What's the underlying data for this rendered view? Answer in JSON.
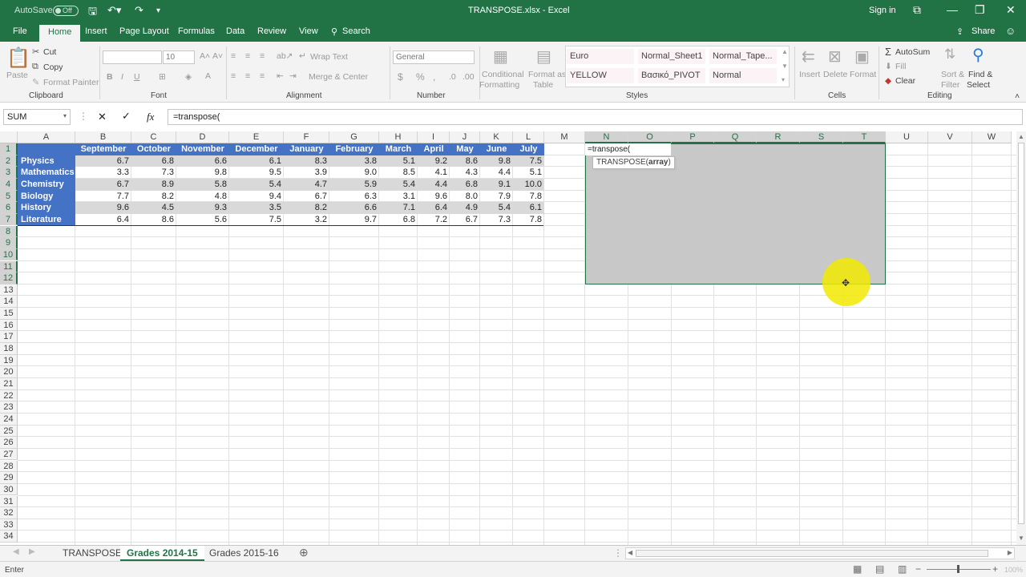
{
  "titlebar": {
    "autosave_label": "AutoSave",
    "autosave_state": "Off",
    "title": "TRANSPOSE.xlsx - Excel",
    "signin": "Sign in"
  },
  "tabs": [
    "File",
    "Home",
    "Insert",
    "Page Layout",
    "Formulas",
    "Data",
    "Review",
    "View",
    "Search"
  ],
  "share": "Share",
  "ribbon": {
    "clipboard": {
      "paste": "Paste",
      "cut": "Cut",
      "copy": "Copy",
      "format_painter": "Format Painter",
      "label": "Clipboard"
    },
    "font": {
      "size": "10",
      "label": "Font",
      "bold": "B",
      "italic": "I",
      "underline": "U"
    },
    "alignment": {
      "wrap": "Wrap Text",
      "merge": "Merge & Center",
      "label": "Alignment"
    },
    "number": {
      "format": "General",
      "label": "Number",
      "currency": "$",
      "percent": "%",
      "comma": ","
    },
    "styles": {
      "cond1": "Conditional",
      "cond2": "Formatting",
      "fat1": "Format as",
      "fat2": "Table",
      "items": [
        "Euro",
        "Normal_Sheet1",
        "Normal_Tape...",
        "YELLOW",
        "Βασικό_PIVOT",
        "Normal"
      ],
      "label": "Styles"
    },
    "cells": {
      "insert": "Insert",
      "delete": "Delete",
      "format": "Format",
      "label": "Cells"
    },
    "editing": {
      "autosum": "AutoSum",
      "fill": "Fill",
      "clear": "Clear",
      "sort1": "Sort &",
      "sort2": "Filter",
      "find1": "Find &",
      "find2": "Select",
      "label": "Editing"
    }
  },
  "formula_bar": {
    "name_box": "SUM",
    "fx": "fx",
    "formula": "=transpose("
  },
  "columns": [
    "A",
    "B",
    "C",
    "D",
    "E",
    "F",
    "G",
    "H",
    "I",
    "J",
    "K",
    "L",
    "M",
    "N",
    "O",
    "P",
    "Q",
    "R",
    "S",
    "T",
    "U",
    "V",
    "W"
  ],
  "rows": [
    "1",
    "2",
    "3",
    "4",
    "5",
    "6",
    "7",
    "8",
    "9",
    "10",
    "11",
    "12",
    "13",
    "14",
    "15",
    "16",
    "17",
    "18",
    "19",
    "20",
    "21",
    "22",
    "23",
    "24",
    "25",
    "26",
    "27",
    "28",
    "29",
    "30",
    "31",
    "32",
    "33",
    "34"
  ],
  "table": {
    "header": [
      "September",
      "October",
      "November",
      "December",
      "January",
      "February",
      "March",
      "April",
      "May",
      "June",
      "July"
    ],
    "body": [
      {
        "name": "Physics",
        "values": [
          "6.7",
          "6.8",
          "6.6",
          "6.1",
          "8.3",
          "3.8",
          "5.1",
          "9.2",
          "8.6",
          "9.8",
          "7.5"
        ]
      },
      {
        "name": "Mathematics",
        "values": [
          "3.3",
          "7.3",
          "9.8",
          "9.5",
          "3.9",
          "9.0",
          "8.5",
          "4.1",
          "4.3",
          "4.4",
          "5.1"
        ]
      },
      {
        "name": "Chemistry",
        "values": [
          "6.7",
          "8.9",
          "5.8",
          "5.4",
          "4.7",
          "5.9",
          "5.4",
          "4.4",
          "6.8",
          "9.1",
          "10.0"
        ]
      },
      {
        "name": "Biology",
        "values": [
          "7.7",
          "8.2",
          "4.8",
          "9.4",
          "6.7",
          "6.3",
          "3.1",
          "9.6",
          "8.0",
          "7.9",
          "7.8"
        ]
      },
      {
        "name": "History",
        "values": [
          "9.6",
          "4.5",
          "9.3",
          "3.5",
          "8.2",
          "6.6",
          "7.1",
          "6.4",
          "4.9",
          "5.4",
          "6.1"
        ]
      },
      {
        "name": "Literature",
        "values": [
          "6.4",
          "8.6",
          "5.6",
          "7.5",
          "3.2",
          "9.7",
          "6.8",
          "7.2",
          "6.7",
          "7.3",
          "7.8"
        ]
      }
    ]
  },
  "active_cell": {
    "text": "=transpose(",
    "tooltip": "TRANSPOSE(",
    "tooltip_arg": "array",
    "tooltip_end": ")"
  },
  "sheets": [
    "TRANSPOSE",
    "Grades 2014-15",
    "Grades 2015-16"
  ],
  "status": {
    "mode": "Enter",
    "zoom": "100%"
  }
}
